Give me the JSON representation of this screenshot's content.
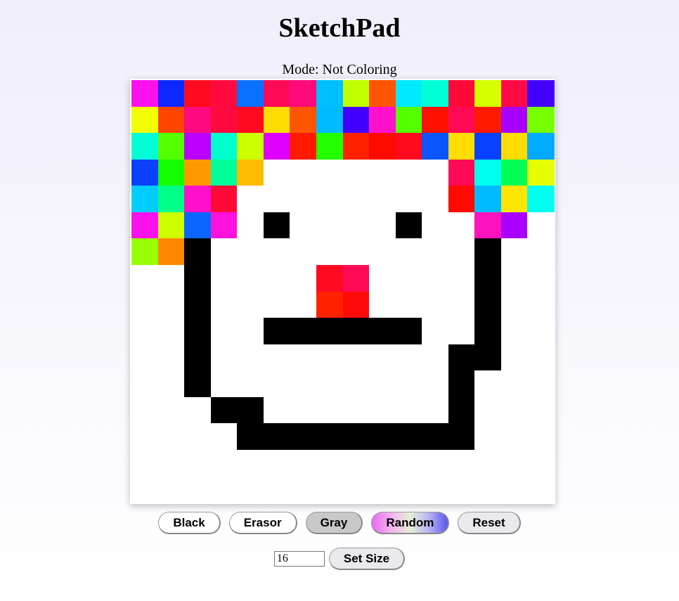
{
  "app": {
    "title": "SketchPad",
    "mode_text": "Mode: Not Coloring"
  },
  "buttons": {
    "black": "Black",
    "erasor": "Erasor",
    "gray": "Gray",
    "random": "Random",
    "reset": "Reset",
    "set_size": "Set Size"
  },
  "size_input": {
    "value": "16"
  },
  "grid": {
    "size": 16,
    "default_color": "#ffffff",
    "cells": [
      [
        "#ff11ee",
        "#0a28ff",
        "#ff0a1e",
        "#ff0a40",
        "#0a70ff",
        "#ff0a55",
        "#ff0a7a",
        "#00bfff",
        "#c0ff00",
        "#ff5500",
        "#00eaff",
        "#00ffd5",
        "#ff0a37",
        "#d6ff00",
        "#ff0a46",
        "#4400ff"
      ],
      [
        "#f3ff00",
        "#ff4400",
        "#ff0a80",
        "#ff0a40",
        "#ff0a1e",
        "#ffdd00",
        "#ff5500",
        "#00bbff",
        "#4400ff",
        "#ff11cc",
        "#55ff00",
        "#ff1100",
        "#ff0a55",
        "#ff1a00",
        "#aa00ff",
        "#77ff00"
      ],
      [
        "#00ffd5",
        "#55ff00",
        "#bb00ff",
        "#00ffcc",
        "#ccff00",
        "#dd00ff",
        "#ff1a00",
        "#22ff00",
        "#ff2200",
        "#ff0a00",
        "#ff0a1e",
        "#0a55ff",
        "#ffdd00",
        "#0a40ff",
        "#ffdd00",
        "#00aaff"
      ],
      [
        "#0a40ff",
        "#11ff00",
        "#ff9900",
        "#00ff99",
        "#ffbb00",
        null,
        null,
        null,
        null,
        null,
        null,
        null,
        "#ff0a55",
        "#00ffee",
        "#00ff55",
        "#e6ff00"
      ],
      [
        "#00ccff",
        "#00ff88",
        "#ff11cc",
        "#ff0a37",
        null,
        null,
        null,
        null,
        null,
        null,
        null,
        null,
        "#ff0a00",
        "#00bbff",
        "#ffe600",
        "#00ffee"
      ],
      [
        "#ff11ee",
        "#ccff00",
        "#0a66ff",
        "#ff11dd",
        null,
        "#000000",
        null,
        null,
        null,
        null,
        "#000000",
        null,
        null,
        "#ff11bb",
        "#aa00ff",
        null
      ],
      [
        "#99ff00",
        "#ff8800",
        "#000000",
        null,
        null,
        null,
        null,
        null,
        null,
        null,
        null,
        null,
        null,
        "#000000",
        null,
        null
      ],
      [
        null,
        null,
        "#000000",
        null,
        null,
        null,
        null,
        "#ff0a22",
        "#ff0a55",
        null,
        null,
        null,
        null,
        "#000000",
        null,
        null
      ],
      [
        null,
        null,
        "#000000",
        null,
        null,
        null,
        null,
        "#ff2200",
        "#ff0a0a",
        null,
        null,
        null,
        null,
        "#000000",
        null,
        null
      ],
      [
        null,
        null,
        "#000000",
        null,
        null,
        "#000000",
        "#000000",
        "#000000",
        "#000000",
        "#000000",
        "#000000",
        null,
        null,
        "#000000",
        null,
        null
      ],
      [
        null,
        null,
        "#000000",
        null,
        null,
        null,
        null,
        null,
        null,
        null,
        null,
        null,
        "#000000",
        "#000000",
        null,
        null
      ],
      [
        null,
        null,
        "#000000",
        null,
        null,
        null,
        null,
        null,
        null,
        null,
        null,
        null,
        "#000000",
        null,
        null,
        null
      ],
      [
        null,
        null,
        null,
        "#000000",
        "#000000",
        null,
        null,
        null,
        null,
        null,
        null,
        null,
        "#000000",
        null,
        null,
        null
      ],
      [
        null,
        null,
        null,
        null,
        "#000000",
        "#000000",
        "#000000",
        "#000000",
        "#000000",
        "#000000",
        "#000000",
        "#000000",
        "#000000",
        null,
        null,
        null
      ],
      [
        null,
        null,
        null,
        null,
        null,
        null,
        null,
        null,
        null,
        null,
        null,
        null,
        null,
        null,
        null,
        null
      ],
      [
        null,
        null,
        null,
        null,
        null,
        null,
        null,
        null,
        null,
        null,
        null,
        null,
        null,
        null,
        null,
        null
      ]
    ]
  }
}
